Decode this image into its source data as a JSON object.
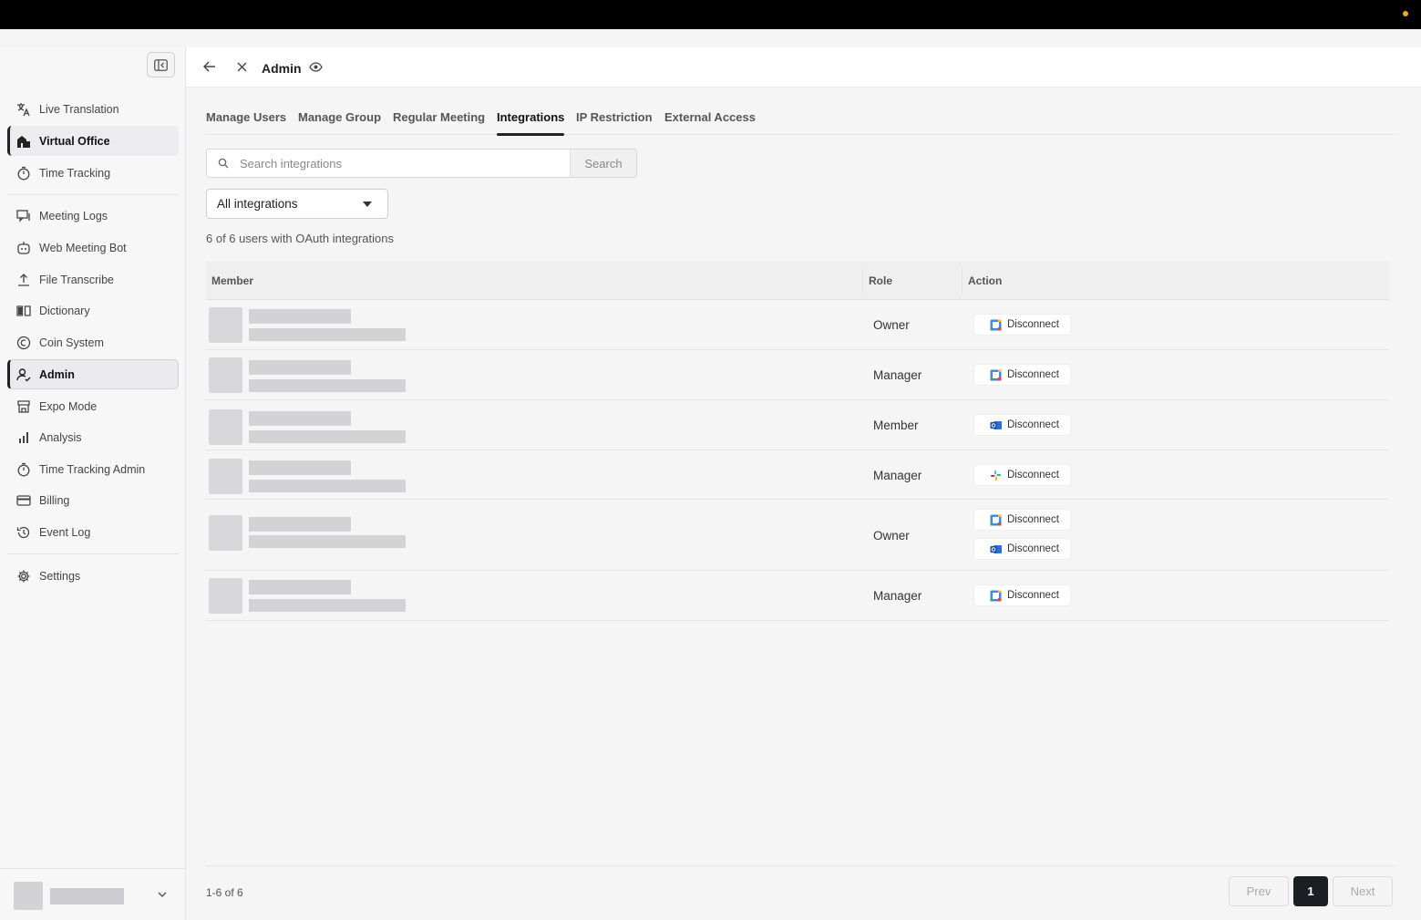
{
  "app": {
    "page_title": "Admin"
  },
  "sidebar": {
    "items": [
      {
        "label": "Live Translation",
        "icon": "translate-icon"
      },
      {
        "label": "Virtual Office",
        "icon": "building-icon"
      },
      {
        "label": "Time Tracking",
        "icon": "stopwatch-icon"
      },
      {
        "label": "Meeting Logs",
        "icon": "chat-log-icon"
      },
      {
        "label": "Web Meeting Bot",
        "icon": "bot-icon"
      },
      {
        "label": "File Transcribe",
        "icon": "upload-icon"
      },
      {
        "label": "Dictionary",
        "icon": "book-icon"
      },
      {
        "label": "Coin System",
        "icon": "coin-icon"
      },
      {
        "label": "Admin",
        "icon": "user-admin-icon"
      },
      {
        "label": "Expo Mode",
        "icon": "store-icon"
      },
      {
        "label": "Analysis",
        "icon": "bar-chart-icon"
      },
      {
        "label": "Time Tracking Admin",
        "icon": "stopwatch-icon"
      },
      {
        "label": "Billing",
        "icon": "credit-card-icon"
      },
      {
        "label": "Event Log",
        "icon": "history-icon"
      },
      {
        "label": "Settings",
        "icon": "gear-icon"
      }
    ]
  },
  "tabs": [
    "Manage Users",
    "Manage Group",
    "Regular Meeting",
    "Integrations",
    "IP Restriction",
    "External Access"
  ],
  "search": {
    "placeholder": "Search integrations",
    "button_label": "Search"
  },
  "filter": {
    "selected": "All integrations"
  },
  "summary": "6 of 6 users with OAuth integrations",
  "table": {
    "headers": {
      "member": "Member",
      "role": "Role",
      "action": "Action"
    },
    "rows": [
      {
        "role": "Owner",
        "actions": [
          {
            "label": "Disconnect",
            "provider_icon": "google-calendar-icon"
          }
        ]
      },
      {
        "role": "Manager",
        "actions": [
          {
            "label": "Disconnect",
            "provider_icon": "google-calendar-icon"
          }
        ]
      },
      {
        "role": "Member",
        "actions": [
          {
            "label": "Disconnect",
            "provider_icon": "outlook-icon"
          }
        ]
      },
      {
        "role": "Manager",
        "actions": [
          {
            "label": "Disconnect",
            "provider_icon": "slack-icon"
          }
        ]
      },
      {
        "role": "Owner",
        "actions": [
          {
            "label": "Disconnect",
            "provider_icon": "google-calendar-icon"
          },
          {
            "label": "Disconnect",
            "provider_icon": "outlook-icon"
          }
        ]
      },
      {
        "role": "Manager",
        "actions": [
          {
            "label": "Disconnect",
            "provider_icon": "google-calendar-icon"
          }
        ]
      }
    ]
  },
  "pagination": {
    "range": "1-6 of 6",
    "prev": "Prev",
    "current": "1",
    "next": "Next"
  },
  "colors": {
    "accent": "#1b1e22",
    "status_dot": "#f5a623",
    "google_blue": "#4285f4",
    "outlook_blue": "#2b6fd6"
  }
}
